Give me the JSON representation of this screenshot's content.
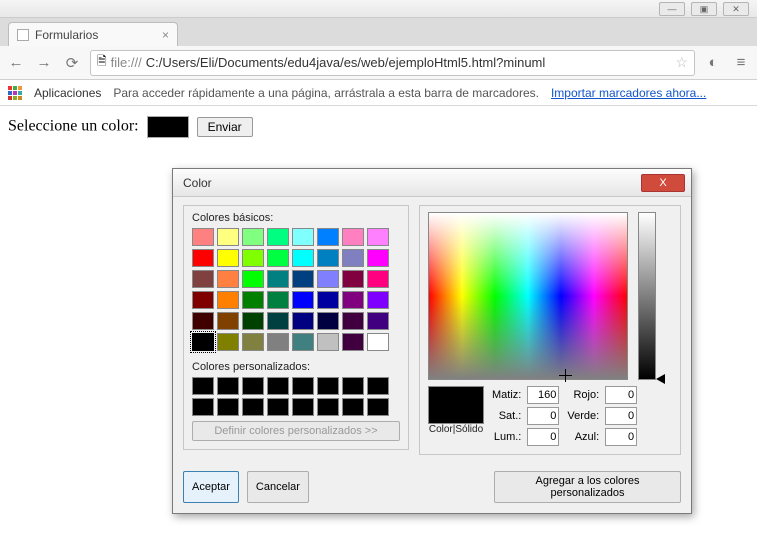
{
  "window": {
    "min_icon": "—",
    "max_icon": "▣",
    "close_icon": "✕"
  },
  "tab": {
    "title": "Formularios",
    "close_glyph": "×"
  },
  "toolbar": {
    "back": "←",
    "fwd": "→",
    "reload": "⟳",
    "url_scheme": "file:///",
    "url_path": "C:/Users/Eli/Documents/edu4java/es/web/ejemploHtml5.html?minuml",
    "star": "☆",
    "menu": "≡",
    "ext": "◐"
  },
  "bookmarks": {
    "apps": "Aplicaciones",
    "hint": "Para acceder rápidamente a una página, arrástrala a esta barra de marcadores.",
    "import": "Importar marcadores ahora..."
  },
  "page": {
    "label": "Seleccione un color:",
    "submit": "Enviar",
    "current_color": "#000000"
  },
  "dialog": {
    "title": "Color",
    "close_glyph": "X",
    "basic_label": "Colores básicos:",
    "custom_label": "Colores personalizados:",
    "define_btn": "Definir colores personalizados >>",
    "ok": "Aceptar",
    "cancel": "Cancelar",
    "add": "Agregar a los colores personalizados",
    "sample_label": "Color|Sólido",
    "basic_colors": [
      "#ff8080",
      "#ffff80",
      "#80ff80",
      "#00ff80",
      "#80ffff",
      "#0080ff",
      "#ff80c0",
      "#ff80ff",
      "#ff0000",
      "#ffff00",
      "#80ff00",
      "#00ff40",
      "#00ffff",
      "#0080c0",
      "#8080c0",
      "#ff00ff",
      "#804040",
      "#ff8040",
      "#00ff00",
      "#008080",
      "#004080",
      "#8080ff",
      "#800040",
      "#ff0080",
      "#800000",
      "#ff8000",
      "#008000",
      "#008040",
      "#0000ff",
      "#0000a0",
      "#800080",
      "#8000ff",
      "#400000",
      "#804000",
      "#004000",
      "#004040",
      "#000080",
      "#000040",
      "#400040",
      "#400080",
      "#000000",
      "#808000",
      "#808040",
      "#808080",
      "#408080",
      "#c0c0c0",
      "#400040",
      "#ffffff"
    ],
    "selected_basic_index": 40,
    "custom_colors": [
      "#000000",
      "#000000",
      "#000000",
      "#000000",
      "#000000",
      "#000000",
      "#000000",
      "#000000",
      "#000000",
      "#000000",
      "#000000",
      "#000000",
      "#000000",
      "#000000",
      "#000000",
      "#000000"
    ],
    "fields": {
      "hue_label": "Matiz:",
      "hue": "160",
      "sat_label": "Sat.:",
      "sat": "0",
      "lum_label": "Lum.:",
      "lum": "0",
      "red_label": "Rojo:",
      "red": "0",
      "green_label": "Verde:",
      "green": "0",
      "blue_label": "Azul:",
      "blue": "0"
    }
  }
}
